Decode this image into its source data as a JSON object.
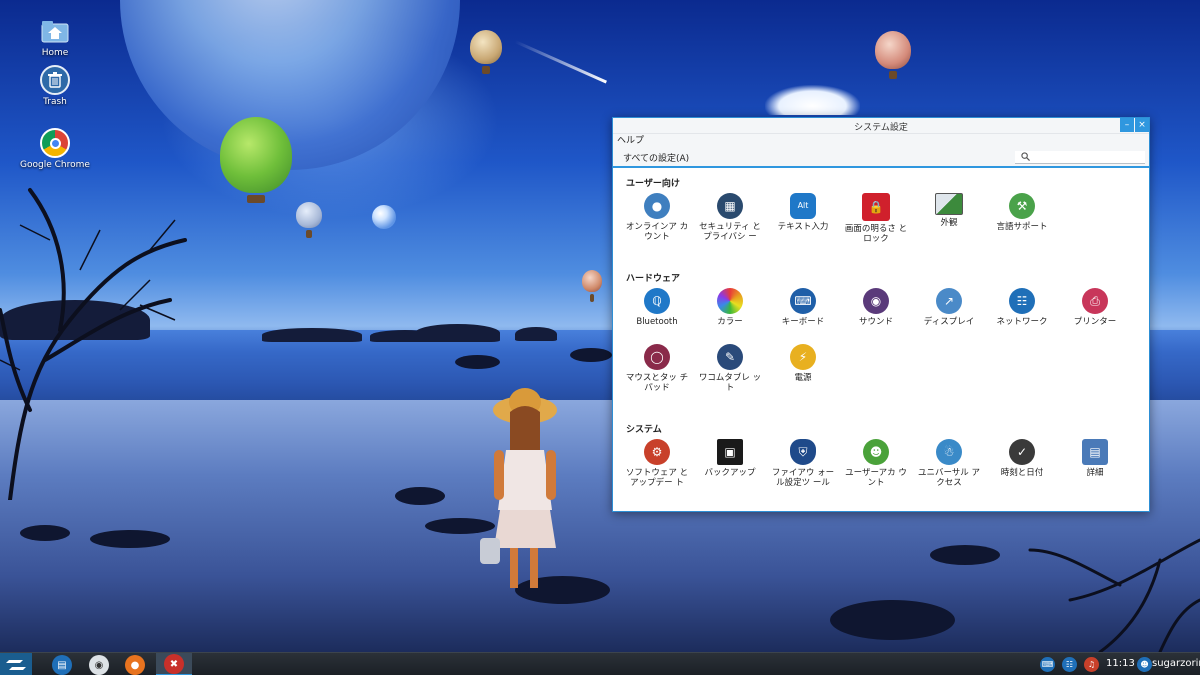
{
  "desktop": {
    "icons": [
      {
        "label": "Home"
      },
      {
        "label": "Trash"
      },
      {
        "label": "Google Chrome"
      }
    ]
  },
  "window": {
    "title": "システム設定",
    "menu_help": "ヘルプ",
    "tab_all": "すべての設定(A)",
    "search_placeholder": "",
    "minimize_glyph": "–",
    "close_glyph": "×"
  },
  "sections": {
    "personal": {
      "title": "ユーザー向け",
      "items": [
        {
          "label": "オンラインア カウント",
          "icon": "online-accounts-icon",
          "color": "#3f7fbf"
        },
        {
          "label": "セキュリティ とプライバシ ー",
          "icon": "security-privacy-icon",
          "color": "#2a4a6e"
        },
        {
          "label": "テキスト入力",
          "icon": "text-input-icon",
          "color": "#1f78c8"
        },
        {
          "label": "画面の明るさ とロック",
          "icon": "brightness-lock-icon",
          "color": "#d0202c"
        },
        {
          "label": "外観",
          "icon": "appearance-icon",
          "color": "#3c8a3c"
        },
        {
          "label": "言語サポート",
          "icon": "language-support-icon",
          "color": "#4aa24a"
        }
      ]
    },
    "hardware": {
      "title": "ハードウェア",
      "items": [
        {
          "label": "Bluetooth",
          "icon": "bluetooth-icon",
          "color": "#1f78c8"
        },
        {
          "label": "カラー",
          "icon": "color-icon",
          "color": "#e8a020"
        },
        {
          "label": "キーボード",
          "icon": "keyboard-icon",
          "color": "#1f5fa8"
        },
        {
          "label": "サウンド",
          "icon": "sound-icon",
          "color": "#5a3a7a"
        },
        {
          "label": "ディスプレイ",
          "icon": "display-icon",
          "color": "#4a8ac8"
        },
        {
          "label": "ネットワーク",
          "icon": "network-icon",
          "color": "#1f6fb8"
        },
        {
          "label": "プリンター",
          "icon": "printer-icon",
          "color": "#c8365a"
        },
        {
          "label": "マウスとタッ チパッド",
          "icon": "mouse-touchpad-icon",
          "color": "#8a2a4a"
        },
        {
          "label": "ワコムタブレ ット",
          "icon": "wacom-tablet-icon",
          "color": "#2a4a7a"
        },
        {
          "label": "電源",
          "icon": "power-icon",
          "color": "#e8b020"
        }
      ]
    },
    "system": {
      "title": "システム",
      "items": [
        {
          "label": "ソフトウェア とアップデー ト",
          "icon": "software-updates-icon",
          "color": "#c8402a"
        },
        {
          "label": "バックアップ",
          "icon": "backup-icon",
          "color": "#1a1a1a"
        },
        {
          "label": "ファイアウ ォール設定ツ ール",
          "icon": "firewall-icon",
          "color": "#1f4a8a"
        },
        {
          "label": "ユーザーアカ ウント",
          "icon": "user-accounts-icon",
          "color": "#4aa23a"
        },
        {
          "label": "ユニバーサル アクセス",
          "icon": "universal-access-icon",
          "color": "#3a8ac8"
        },
        {
          "label": "時刻と日付",
          "icon": "time-date-icon",
          "color": "#3a3a3a"
        },
        {
          "label": "詳細",
          "icon": "details-icon",
          "color": "#4a7ab8"
        }
      ]
    }
  },
  "taskbar": {
    "clock": "11:13",
    "user": "sugarzorin"
  }
}
